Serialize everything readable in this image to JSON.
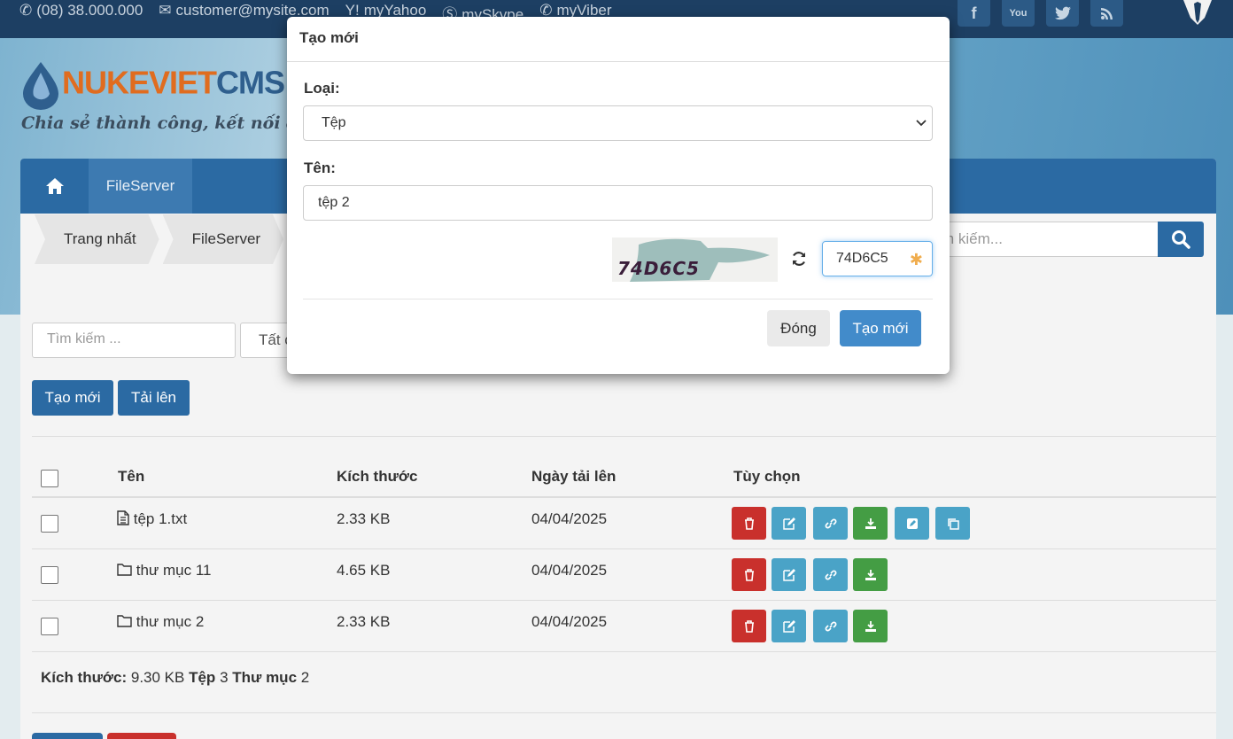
{
  "topbar": {
    "phone": "(08) 38.000.000",
    "email": "customer@mysite.com",
    "yahoo": "myYahoo",
    "skype": "mySkype",
    "viber": "myViber",
    "social_icons": [
      "facebook-icon",
      "youtube-icon",
      "twitter-icon",
      "rss-icon"
    ]
  },
  "brand": {
    "logo_part1": "NUKEVIET",
    "logo_part2": "CMS",
    "slogan": "Chia sẻ thành công, kết nối đam"
  },
  "nav": {
    "tab": "FileServer"
  },
  "breadcrumb": [
    "Trang nhất",
    "FileServer"
  ],
  "header_search": {
    "placeholder": "m kiếm..."
  },
  "filters": {
    "search_placeholder": "Tìm kiếm ...",
    "select_value": "Tất c"
  },
  "toolbar": {
    "create_label": "Tạo mới",
    "upload_label": "Tải lên"
  },
  "table": {
    "headers": {
      "name": "Tên",
      "size": "Kích thước",
      "date": "Ngày tải lên",
      "options": "Tùy chọn"
    },
    "rows": [
      {
        "name": "tệp 1.txt",
        "size": "2.33 KB",
        "date": "04/04/2025",
        "type": "file-icon"
      },
      {
        "name": "thư mục 11",
        "size": "4.65 KB",
        "date": "04/04/2025",
        "type": "folder-icon"
      },
      {
        "name": "thư mục 2",
        "size": "2.33 KB",
        "date": "04/04/2025",
        "type": "folder-icon"
      }
    ]
  },
  "summary": {
    "size_label": "Kích thước:",
    "size_value": "9.30 KB",
    "files_label": "Tệp",
    "files_value": "3",
    "folders_label": "Thư mục",
    "folders_value": "2"
  },
  "modal": {
    "title": "Tạo mới",
    "type_label": "Loại:",
    "type_value": "Tệp",
    "name_label": "Tên:",
    "name_value": "tệp 2",
    "captcha_text": "74D6C5",
    "captcha_input": "74D6C5",
    "close_label": "Đóng",
    "submit_label": "Tạo mới"
  },
  "colors": {
    "primary": "#2b6aa3",
    "danger": "#c9302c",
    "info": "#4aa3c7",
    "success": "#449d44"
  }
}
